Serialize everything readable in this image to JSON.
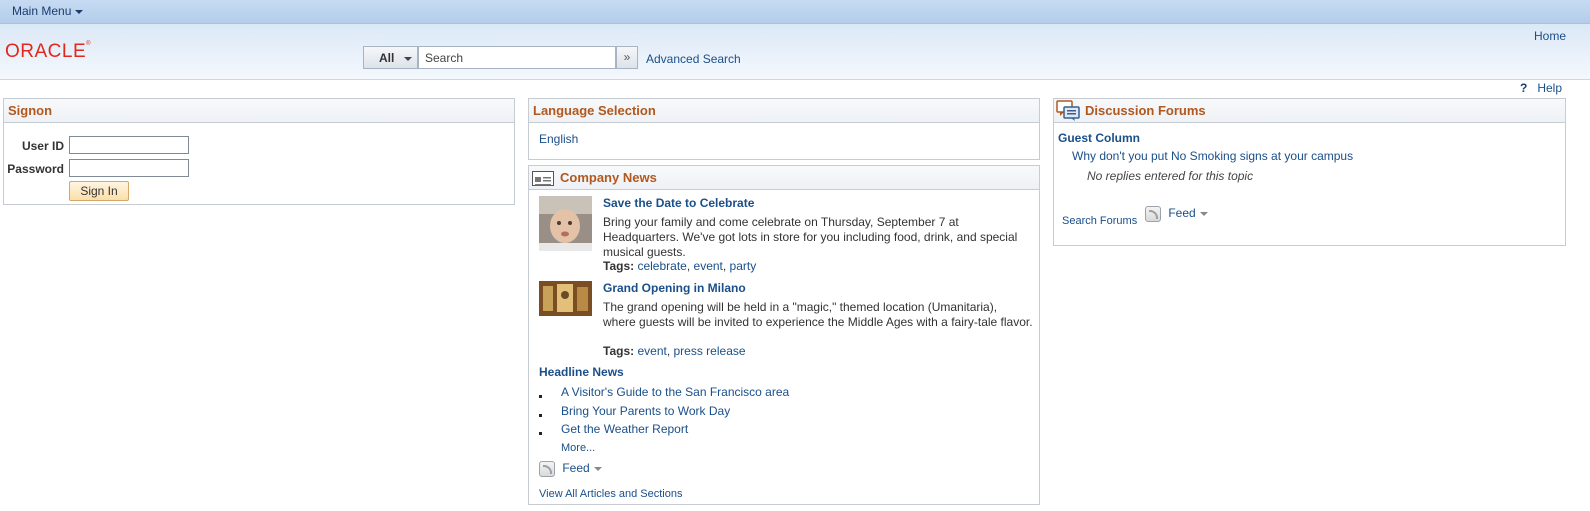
{
  "menubar": {
    "main_menu": "Main Menu"
  },
  "header": {
    "logo": "ORACLE",
    "home": "Home",
    "search": {
      "scope": "All",
      "placeholder": "Search",
      "advanced": "Advanced Search"
    }
  },
  "help": {
    "label": "Help"
  },
  "signon": {
    "title": "Signon",
    "user_id_label": "User ID",
    "password_label": "Password",
    "sign_in": "Sign In"
  },
  "language": {
    "title": "Language Selection",
    "options": [
      "English"
    ]
  },
  "company_news": {
    "title": "Company News",
    "articles": [
      {
        "title": "Save the Date to Celebrate",
        "body": "Bring your family and come celebrate on Thursday, September 7 at Headquarters. We've got lots in store for you including food, drink, and special musical guests.",
        "tags_label": "Tags:",
        "tags": [
          "celebrate",
          "event",
          "party"
        ]
      },
      {
        "title": "Grand Opening in Milano",
        "body": "The grand opening will be held in a \"magic,\" themed location (Umanitaria), where guests will be invited to experience the Middle Ages with a fairy-tale flavor.",
        "tags_label": "Tags:",
        "tags": [
          "event",
          "press release"
        ]
      }
    ],
    "headline_title": "Headline News",
    "headlines": [
      "A Visitor's Guide to the San Francisco area",
      "Bring Your Parents to Work Day",
      "Get the Weather Report"
    ],
    "more": "More...",
    "feed": "Feed",
    "view_all": "View All Articles and Sections"
  },
  "forums": {
    "title": "Discussion Forums",
    "column": "Guest Column",
    "topic": "Why don't you put No Smoking signs at your campus",
    "no_replies": "No replies entered for this topic",
    "search": "Search Forums",
    "feed": "Feed"
  }
}
